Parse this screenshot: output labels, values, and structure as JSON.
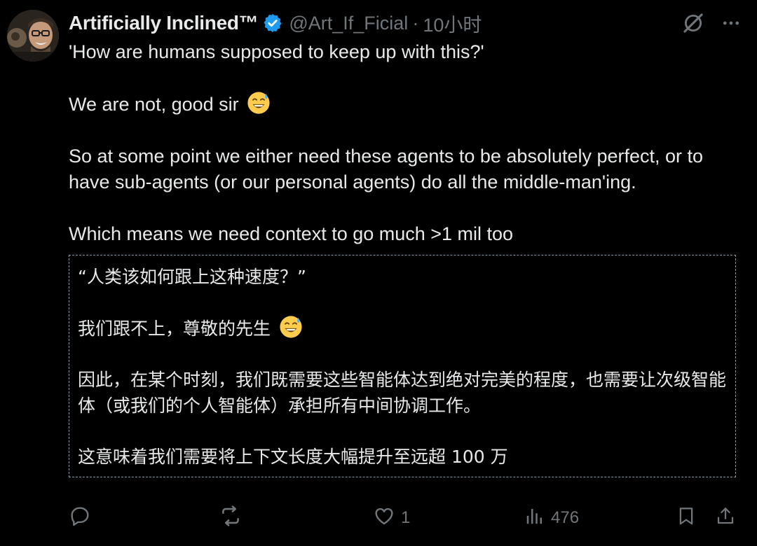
{
  "author": {
    "display_name": "Artificially Inclined™",
    "handle": "@Art_If_Ficial",
    "separator": "·",
    "time": "10小时",
    "verified": true,
    "verified_color": "#1d9bf0"
  },
  "tweet": {
    "paragraphs": [
      "'How are humans supposed to keep up with this?'",
      "We are not, good sir",
      "So at some point we either need these agents to be absolutely perfect, or to have sub-agents (or our personal agents) do all the middle-man'ing.",
      "Which means we need context to go much >1 mil too"
    ],
    "emoji": "grinning-face-with-sweat"
  },
  "translation": {
    "paragraphs": [
      "“人类该如何跟上这种速度？”",
      "我们跟不上，尊敬的先生",
      "因此，在某个时刻，我们既需要这些智能体达到绝对完美的程度，也需要让次级智能体（或我们的个人智能体）承担所有中间协调工作。",
      "这意味着我们需要将上下文长度大幅提升至远超 100 万"
    ]
  },
  "actions": {
    "reply_count": "",
    "repost_count": "",
    "like_count": "1",
    "views_count": "476"
  },
  "icons": {
    "top_right": [
      "grok-icon",
      "more-icon"
    ],
    "actions": [
      "reply-icon",
      "repost-icon",
      "like-icon",
      "views-icon",
      "bookmark-icon",
      "share-icon"
    ]
  },
  "colors": {
    "background": "#000000",
    "text": "#e7e9ea",
    "muted": "#71767b",
    "accent": "#1d9bf0"
  }
}
